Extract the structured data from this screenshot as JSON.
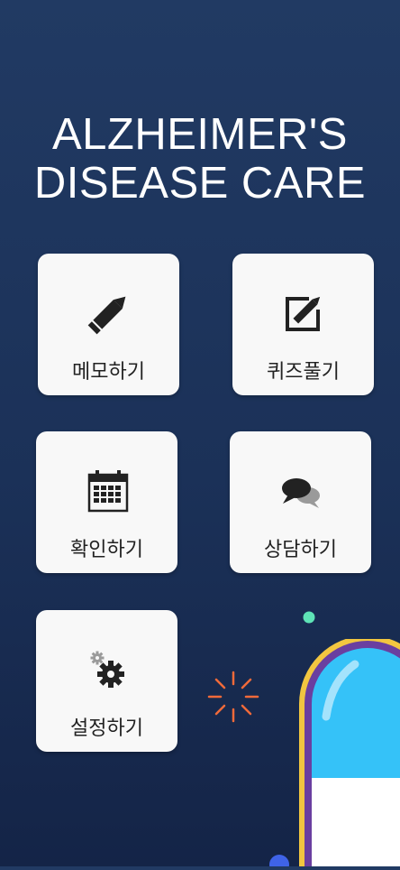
{
  "app": {
    "title_line1": "ALZHEIMER'S",
    "title_line2": "DISEASE CARE"
  },
  "menu": [
    {
      "id": "memo",
      "label": "메모하기",
      "icon": "pencil-icon"
    },
    {
      "id": "quiz",
      "label": "퀴즈풀기",
      "icon": "edit-box-icon"
    },
    {
      "id": "check",
      "label": "확인하기",
      "icon": "calendar-icon"
    },
    {
      "id": "consult",
      "label": "상담하기",
      "icon": "chat-bubbles-icon"
    },
    {
      "id": "settings",
      "label": "설정하기",
      "icon": "gears-icon"
    }
  ],
  "colors": {
    "background_top": "#213a63",
    "background_bottom": "#142447",
    "card": "#f8f8f8",
    "pill_blue": "#35c2f8",
    "pill_outline": "#6a3fa0",
    "pill_rim": "#f2c640",
    "dot_mint": "#5ee3b6",
    "sparkle": "#f06a3a"
  }
}
